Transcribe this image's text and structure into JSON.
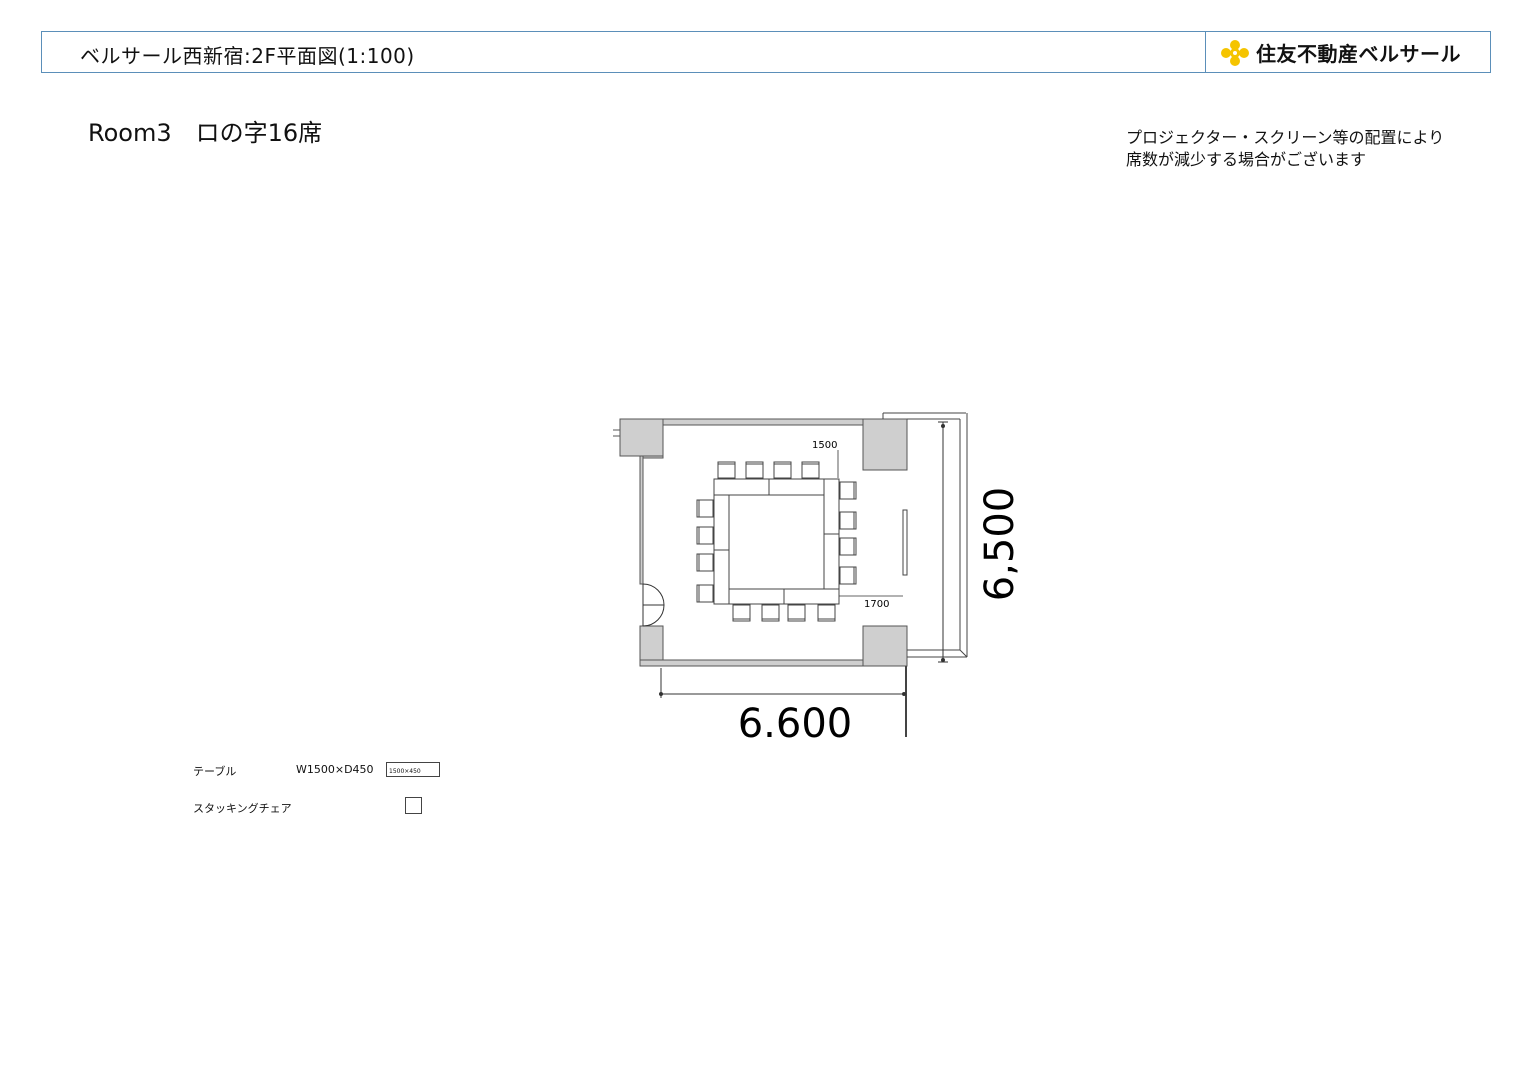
{
  "header": {
    "title": "ベルサール西新宿:2F平面図(1:100)",
    "brand": "住友不動産ベルサール",
    "brand_color": "#f5c400",
    "border_color": "#5b8fb9",
    "logo_icon": "flower-logo-icon"
  },
  "room": {
    "title": "Room3　ロの字16席"
  },
  "note": {
    "line1": "プロジェクター・スクリーン等の配置により",
    "line2": "席数が減少する場合がございます"
  },
  "plan": {
    "width_label": "6.600",
    "height_label": "6,500",
    "table_dim_label": "1500",
    "gap_dim_label": "1700",
    "seat_count": 16,
    "wall_color": "#cfcfcf"
  },
  "legend": {
    "table_label": "テーブル",
    "table_size": "W1500×D450",
    "table_box_text": "1500×450",
    "chair_label": "スタッキングチェア"
  }
}
